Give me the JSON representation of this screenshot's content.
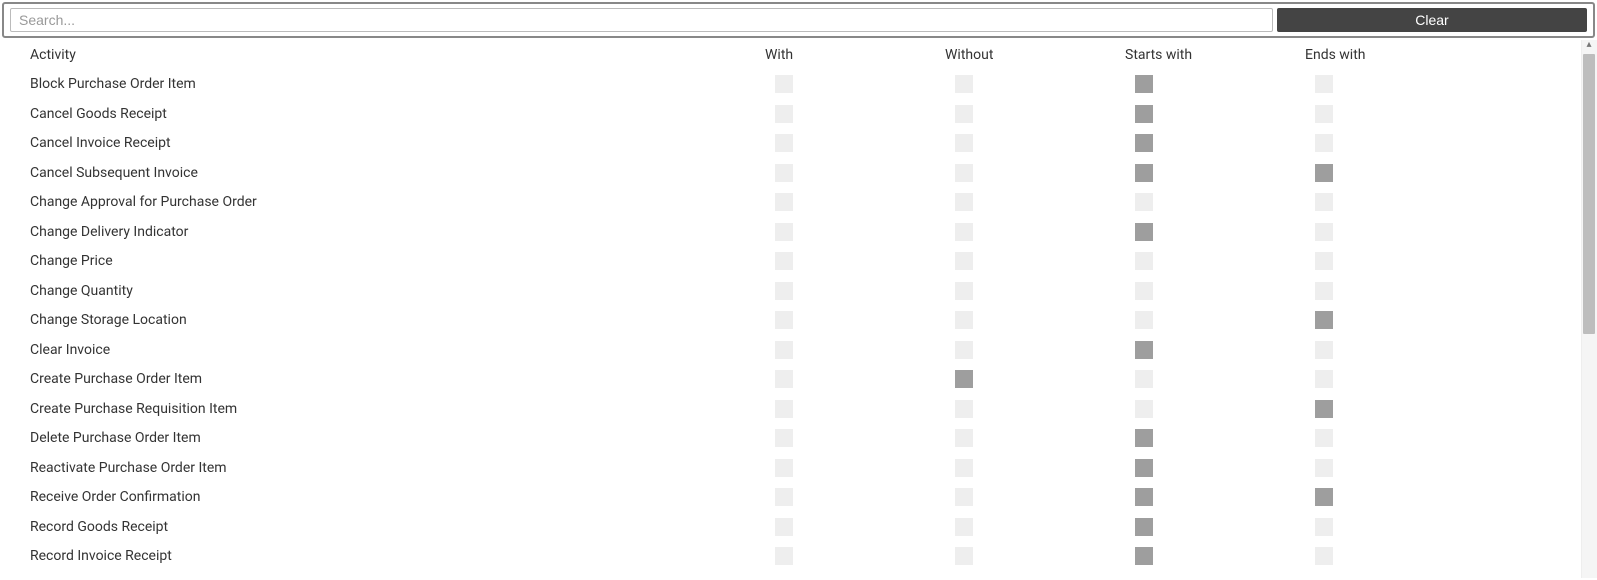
{
  "search": {
    "placeholder": "Search...",
    "value": ""
  },
  "buttons": {
    "clear": "Clear"
  },
  "columns": {
    "activity": "Activity",
    "with": "With",
    "without": "Without",
    "starts": "Starts with",
    "ends": "Ends with"
  },
  "rows": [
    {
      "activity": "Block Purchase Order Item",
      "with": false,
      "without": false,
      "starts": true,
      "ends": false
    },
    {
      "activity": "Cancel Goods Receipt",
      "with": false,
      "without": false,
      "starts": true,
      "ends": false
    },
    {
      "activity": "Cancel Invoice Receipt",
      "with": false,
      "without": false,
      "starts": true,
      "ends": false
    },
    {
      "activity": "Cancel Subsequent Invoice",
      "with": false,
      "without": false,
      "starts": true,
      "ends": true
    },
    {
      "activity": "Change Approval for Purchase Order",
      "with": false,
      "without": false,
      "starts": false,
      "ends": false
    },
    {
      "activity": "Change Delivery Indicator",
      "with": false,
      "without": false,
      "starts": true,
      "ends": false
    },
    {
      "activity": "Change Price",
      "with": false,
      "without": false,
      "starts": false,
      "ends": false
    },
    {
      "activity": "Change Quantity",
      "with": false,
      "without": false,
      "starts": false,
      "ends": false
    },
    {
      "activity": "Change Storage Location",
      "with": false,
      "without": false,
      "starts": false,
      "ends": true
    },
    {
      "activity": "Clear Invoice",
      "with": false,
      "without": false,
      "starts": true,
      "ends": false
    },
    {
      "activity": "Create Purchase Order Item",
      "with": false,
      "without": true,
      "starts": false,
      "ends": false
    },
    {
      "activity": "Create Purchase Requisition Item",
      "with": false,
      "without": false,
      "starts": false,
      "ends": true
    },
    {
      "activity": "Delete Purchase Order Item",
      "with": false,
      "without": false,
      "starts": true,
      "ends": false
    },
    {
      "activity": "Reactivate Purchase Order Item",
      "with": false,
      "without": false,
      "starts": true,
      "ends": false
    },
    {
      "activity": "Receive Order Confirmation",
      "with": false,
      "without": false,
      "starts": true,
      "ends": true
    },
    {
      "activity": "Record Goods Receipt",
      "with": false,
      "without": false,
      "starts": true,
      "ends": false
    },
    {
      "activity": "Record Invoice Receipt",
      "with": false,
      "without": false,
      "starts": true,
      "ends": false
    }
  ]
}
